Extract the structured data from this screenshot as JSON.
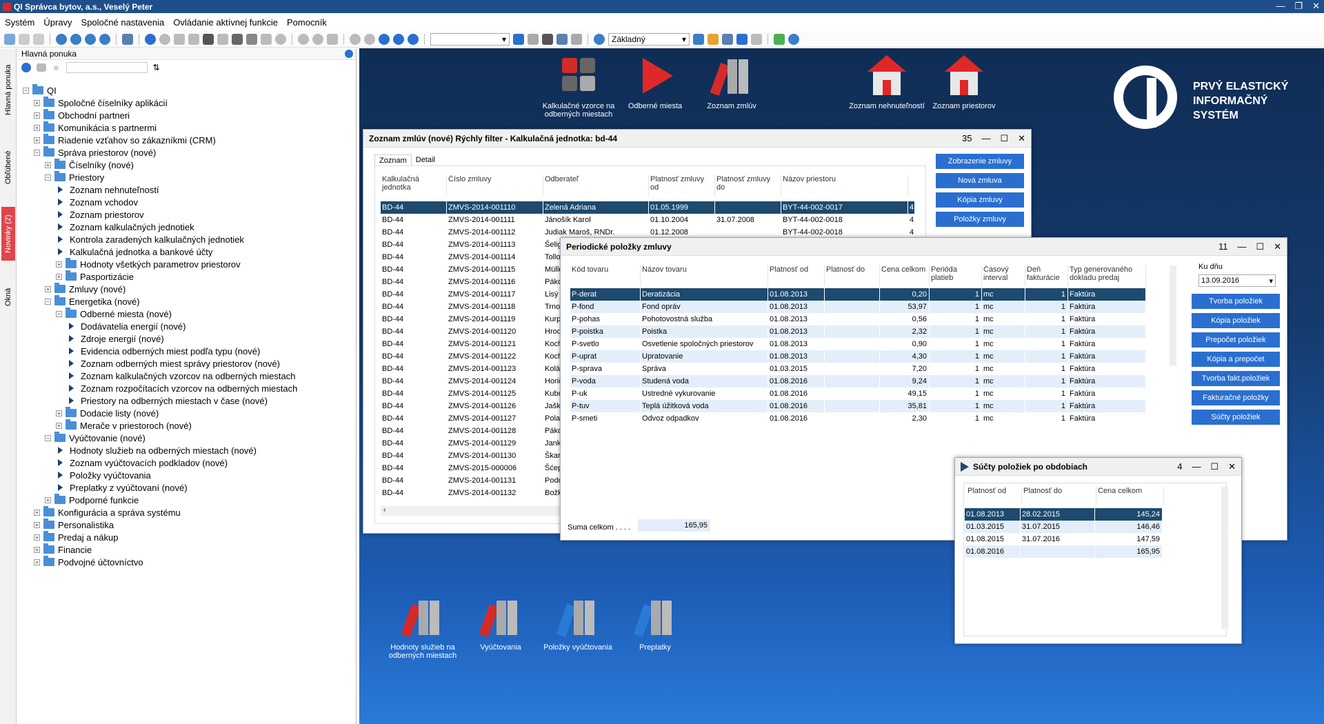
{
  "app": {
    "title": "QI Správca bytov, a.s., Veselý Peter"
  },
  "menu": [
    "Systém",
    "Úpravy",
    "Spoločné nastavenia",
    "Ovládanie aktívnej funkcie",
    "Pomocník"
  ],
  "toolbar": {
    "combo_empty": "",
    "view_combo": "Základný"
  },
  "sidetabs": {
    "main": "Hlavná ponuka",
    "favorites": "Obľúbené",
    "news": "Novinky (2)",
    "windows": "Okná"
  },
  "leftpanel": {
    "title": "Hlavná ponuka"
  },
  "tree": [
    {
      "label": "QI",
      "level": 0,
      "type": "folder",
      "exp": "−"
    },
    {
      "label": "Spoločné číselníky aplikácií",
      "level": 1,
      "type": "folder",
      "exp": "+"
    },
    {
      "label": "Obchodní partneri",
      "level": 1,
      "type": "folder",
      "exp": "+"
    },
    {
      "label": "Komunikácia s partnermi",
      "level": 1,
      "type": "folder",
      "exp": "+"
    },
    {
      "label": "Riadenie vzťahov so zákazníkmi (CRM)",
      "level": 1,
      "type": "folder",
      "exp": "+"
    },
    {
      "label": "Správa priestorov (nové)",
      "level": 1,
      "type": "folder",
      "exp": "−"
    },
    {
      "label": "Číselníky (nové)",
      "level": 2,
      "type": "folder",
      "exp": "+"
    },
    {
      "label": "Priestory",
      "level": 2,
      "type": "folder",
      "exp": "−"
    },
    {
      "label": "Zoznam nehnuteľností",
      "level": 3,
      "type": "leaf"
    },
    {
      "label": "Zoznam vchodov",
      "level": 3,
      "type": "leaf"
    },
    {
      "label": "Zoznam priestorov",
      "level": 3,
      "type": "leaf"
    },
    {
      "label": "Zoznam kalkulačných jednotiek",
      "level": 3,
      "type": "leaf"
    },
    {
      "label": "Kontrola zaradených kalkulačných jednotiek",
      "level": 3,
      "type": "leaf"
    },
    {
      "label": "Kalkulačná jednotka a bankové účty",
      "level": 3,
      "type": "leaf"
    },
    {
      "label": "Hodnoty všetkých parametrov priestorov",
      "level": 3,
      "type": "folder",
      "exp": "+"
    },
    {
      "label": "Pasportizácie",
      "level": 3,
      "type": "folder",
      "exp": "+"
    },
    {
      "label": "Zmluvy (nové)",
      "level": 2,
      "type": "folder",
      "exp": "+"
    },
    {
      "label": "Energetika (nové)",
      "level": 2,
      "type": "folder",
      "exp": "−"
    },
    {
      "label": "Odberné miesta (nové)",
      "level": 3,
      "type": "folder",
      "exp": "−"
    },
    {
      "label": "Dodávatelia energií (nové)",
      "level": 4,
      "type": "leaf"
    },
    {
      "label": "Zdroje energií (nové)",
      "level": 4,
      "type": "leaf"
    },
    {
      "label": "Evidencia odberných miest podľa typu (nové)",
      "level": 4,
      "type": "leaf"
    },
    {
      "label": "Zoznam odberných miest správy priestorov (nové)",
      "level": 4,
      "type": "leaf"
    },
    {
      "label": "Zoznam kalkulačných vzorcov na odberných miestach",
      "level": 4,
      "type": "leaf"
    },
    {
      "label": "Zoznam rozpočítacích vzorcov na odberných miestach",
      "level": 4,
      "type": "leaf"
    },
    {
      "label": "Priestory na odberných miestach v čase (nové)",
      "level": 4,
      "type": "leaf"
    },
    {
      "label": "Dodacie listy (nové)",
      "level": 3,
      "type": "folder",
      "exp": "+"
    },
    {
      "label": "Merače v priestoroch (nové)",
      "level": 3,
      "type": "folder",
      "exp": "+"
    },
    {
      "label": "Vyúčtovanie (nové)",
      "level": 2,
      "type": "folder",
      "exp": "−"
    },
    {
      "label": "Hodnoty služieb na odberných miestach (nové)",
      "level": 3,
      "type": "leaf"
    },
    {
      "label": "Zoznam vyúčtovacích podkladov (nové)",
      "level": 3,
      "type": "leaf"
    },
    {
      "label": "Položky vyúčtovania",
      "level": 3,
      "type": "leaf"
    },
    {
      "label": "Preplatky z vyúčtovaní (nové)",
      "level": 3,
      "type": "leaf"
    },
    {
      "label": "Podporné funkcie",
      "level": 2,
      "type": "folder",
      "exp": "+"
    },
    {
      "label": "Konfigurácia a správa systému",
      "level": 1,
      "type": "folder",
      "exp": "+"
    },
    {
      "label": "Personalistika",
      "level": 1,
      "type": "folder",
      "exp": "+"
    },
    {
      "label": "Predaj a nákup",
      "level": 1,
      "type": "folder",
      "exp": "+"
    },
    {
      "label": "Financie",
      "level": 1,
      "type": "folder",
      "exp": "+"
    },
    {
      "label": "Podvojné účtovníctvo",
      "level": 1,
      "type": "folder",
      "exp": "+"
    }
  ],
  "desktop_icons": {
    "top": [
      {
        "label": "Kalkulačné vzorce na odberných miestach",
        "icon": "calculator-icon"
      },
      {
        "label": "Odberné miesta",
        "icon": "play-icon"
      },
      {
        "label": "Zoznam zmlúv",
        "icon": "binders-icon"
      },
      {
        "label": "Zoznam nehnuteľností",
        "icon": "house-icon"
      },
      {
        "label": "Zoznam priestorov",
        "icon": "house-icon"
      }
    ],
    "bottom": [
      {
        "label": "Hodnoty služieb na odberných miestach",
        "icon": "binders-icon",
        "color": "#d42a2a"
      },
      {
        "label": "Vyúčtovania",
        "icon": "binders-icon",
        "color": "#d42a2a"
      },
      {
        "label": "Položky vyúčtovania",
        "icon": "binders-icon",
        "color": "#2a7ad8"
      },
      {
        "label": "Preplatky",
        "icon": "binders-icon",
        "color": "#2a7ad8"
      }
    ]
  },
  "logo": {
    "line1": "PRVÝ ELASTICKÝ",
    "line2": "INFORMAČNÝ",
    "line3": "SYSTÉM",
    "mark": "QI"
  },
  "contracts": {
    "title": "Zoznam zmlúv (nové)   Rýchly filter -  Kalkulačná jednotka: bd-44",
    "count": "35",
    "tabs": [
      "Zoznam",
      "Detail"
    ],
    "headers": [
      "Kalkulačná jednotka",
      "Číslo zmluvy",
      "Odberateľ",
      "Platnosť zmluvy od",
      "Platnosť zmluvy do",
      "Názov priestoru"
    ],
    "rows": [
      [
        "BD-44",
        "ZMVS-2014-001110",
        "Zelená Adriana",
        "01.05.1999",
        "",
        "BYT-44-002-0017",
        "4"
      ],
      [
        "BD-44",
        "ZMVS-2014-001111",
        "Jánošík Karol",
        "01.10.2004",
        "31.07.2008",
        "BYT-44-002-0018",
        "4"
      ],
      [
        "BD-44",
        "ZMVS-2014-001112",
        "Judiak Maroš, RNDr.",
        "01.12.2008",
        "",
        "BYT-44-002-0018",
        "4"
      ],
      [
        "BD-44",
        "ZMVS-2014-001113",
        "Šelig",
        "",
        "",
        "",
        ""
      ],
      [
        "BD-44",
        "ZMVS-2014-001114",
        "Tollo",
        "",
        "",
        "",
        ""
      ],
      [
        "BD-44",
        "ZMVS-2014-001115",
        "Mülle",
        "",
        "",
        "",
        ""
      ],
      [
        "BD-44",
        "ZMVS-2014-001116",
        "Páko",
        "",
        "",
        "",
        ""
      ],
      [
        "BD-44",
        "ZMVS-2014-001117",
        "Lisý I",
        "",
        "",
        "",
        ""
      ],
      [
        "BD-44",
        "ZMVS-2014-001118",
        "Trno",
        "",
        "",
        "",
        ""
      ],
      [
        "BD-44",
        "ZMVS-2014-001119",
        "Kurp",
        "",
        "",
        "",
        ""
      ],
      [
        "BD-44",
        "ZMVS-2014-001120",
        "Hrod",
        "",
        "",
        "",
        ""
      ],
      [
        "BD-44",
        "ZMVS-2014-001121",
        "Koch",
        "",
        "",
        "",
        ""
      ],
      [
        "BD-44",
        "ZMVS-2014-001122",
        "Koch",
        "",
        "",
        "",
        ""
      ],
      [
        "BD-44",
        "ZMVS-2014-001123",
        "Kolár",
        "",
        "",
        "",
        ""
      ],
      [
        "BD-44",
        "ZMVS-2014-001124",
        "Horič",
        "",
        "",
        "",
        ""
      ],
      [
        "BD-44",
        "ZMVS-2014-001125",
        "Kubo",
        "",
        "",
        "",
        ""
      ],
      [
        "BD-44",
        "ZMVS-2014-001126",
        "Jaška",
        "",
        "",
        "",
        ""
      ],
      [
        "BD-44",
        "ZMVS-2014-001127",
        "Polak",
        "",
        "",
        "",
        ""
      ],
      [
        "BD-44",
        "ZMVS-2014-001128",
        "Páko",
        "",
        "",
        "",
        ""
      ],
      [
        "BD-44",
        "ZMVS-2014-001129",
        "Jank",
        "",
        "",
        "",
        ""
      ],
      [
        "BD-44",
        "ZMVS-2014-001130",
        "Škarl",
        "",
        "",
        "",
        ""
      ],
      [
        "BD-44",
        "ZMVS-2015-000006",
        "Šćep",
        "",
        "",
        "",
        ""
      ],
      [
        "BD-44",
        "ZMVS-2014-001131",
        "Podo",
        "",
        "",
        "",
        ""
      ],
      [
        "BD-44",
        "ZMVS-2014-001132",
        "Božk",
        "",
        "",
        "",
        ""
      ]
    ],
    "buttons": [
      "Zobrazenie zmluvy",
      "Nová zmluva",
      "Kópia zmluvy",
      "Položky zmluvy"
    ]
  },
  "periodic": {
    "title": "Periodické položky zmluvy",
    "count": "11",
    "headers": [
      "Kód tovaru",
      "Názov tovaru",
      "Platnosť od",
      "Platnosť do",
      "Cena celkom",
      "Perióda platieb",
      "Časový interval",
      "Deň fakturácie",
      "Typ generovaného dokladu predaj"
    ],
    "rows": [
      [
        "P-derat",
        "Deratizácia",
        "01.08.2013",
        "",
        "0,20",
        "1",
        "mc",
        "1",
        "Faktúra"
      ],
      [
        "P-fond",
        "Fond opráv",
        "01.08.2013",
        "",
        "53,97",
        "1",
        "mc",
        "1",
        "Faktúra"
      ],
      [
        "P-pohas",
        "Pohotovostná služba",
        "01.08.2013",
        "",
        "0,56",
        "1",
        "mc",
        "1",
        "Faktúra"
      ],
      [
        "P-poistka",
        "Poistka",
        "01.08.2013",
        "",
        "2,32",
        "1",
        "mc",
        "1",
        "Faktúra"
      ],
      [
        "P-svetlo",
        "Osvetlenie spoločných priestorov",
        "01.08.2013",
        "",
        "0,90",
        "1",
        "mc",
        "1",
        "Faktúra"
      ],
      [
        "P-uprat",
        "Upratovanie",
        "01.08.2013",
        "",
        "4,30",
        "1",
        "mc",
        "1",
        "Faktúra"
      ],
      [
        "P-sprava",
        "Správa",
        "01.03.2015",
        "",
        "7,20",
        "1",
        "mc",
        "1",
        "Faktúra"
      ],
      [
        "P-voda",
        "Studená voda",
        "01.08.2016",
        "",
        "9,24",
        "1",
        "mc",
        "1",
        "Faktúra"
      ],
      [
        "P-uk",
        "Ustredné vykurovanie",
        "01.08.2016",
        "",
        "49,15",
        "1",
        "mc",
        "1",
        "Faktúra"
      ],
      [
        "P-tuv",
        "Teplá úžitková voda",
        "01.08.2016",
        "",
        "35,81",
        "1",
        "mc",
        "1",
        "Faktúra"
      ],
      [
        "P-smeti",
        "Odvoz odpadkov",
        "01.08.2016",
        "",
        "2,30",
        "1",
        "mc",
        "1",
        "Faktúra"
      ]
    ],
    "date_label": "Ku dňu",
    "date_value": "13.09.2016",
    "buttons": [
      "Tvorba položiek",
      "Kópia položiek",
      "Prepočet položiek",
      "Kópia a prepočet",
      "Tvorba fakt.položiek",
      "Fakturačné položky",
      "Súčty položiek"
    ],
    "sum_label": "Suma celkom . . . .",
    "sum_value": "165,95"
  },
  "sums": {
    "title": "Súčty položiek po obdobiach",
    "count": "4",
    "headers": [
      "Platnosť od",
      "Platnosť do",
      "Cena celkom"
    ],
    "rows": [
      [
        "01.08.2013",
        "28.02.2015",
        "145,24"
      ],
      [
        "01.03.2015",
        "31.07.2015",
        "146,46"
      ],
      [
        "01.08.2015",
        "31.07.2016",
        "147,59"
      ],
      [
        "01.08.2016",
        "",
        "165,95"
      ]
    ]
  },
  "colors": {
    "selection": "#1d4a6e",
    "button": "#2a6fd0",
    "alt_row": "#e4eefa",
    "title_bar": "#1f4f8b"
  }
}
